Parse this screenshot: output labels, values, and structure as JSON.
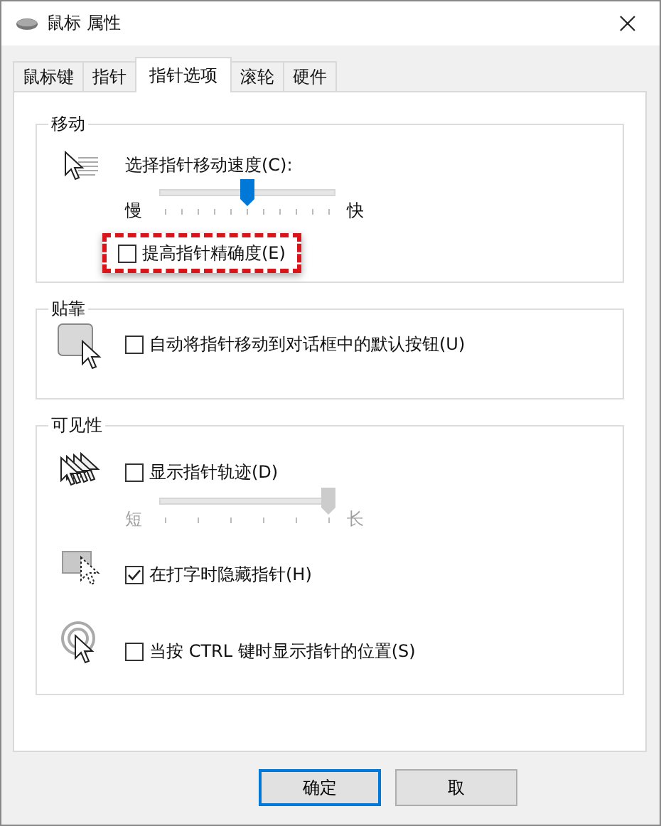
{
  "window": {
    "title": "鼠标 属性"
  },
  "tabs": [
    {
      "label": "鼠标键",
      "selected": false
    },
    {
      "label": "指针",
      "selected": false
    },
    {
      "label": "指针选项",
      "selected": true
    },
    {
      "label": "滚轮",
      "selected": false
    },
    {
      "label": "硬件",
      "selected": false
    }
  ],
  "groups": [
    {
      "title": "移动",
      "sections": [
        {
          "items": [
            {
              "kind": "label",
              "text": "选择指针移动速度(C):"
            },
            {
              "kind": "slider",
              "min_label": "慢",
              "max_label": "快",
              "level": 0.5,
              "disabled": false
            }
          ]
        },
        {
          "items": [
            {
              "kind": "checkbox",
              "label": "提高指针精确度(E)",
              "checked": false,
              "highlighted": true
            }
          ]
        }
      ]
    },
    {
      "title": "贴靠",
      "sections": [
        {
          "items": [
            {
              "kind": "checkbox",
              "label": "自动将指针移动到对话框中的默认按钮(U)",
              "checked": false,
              "highlighted": false
            }
          ]
        }
      ]
    },
    {
      "title": "可见性",
      "sections": [
        {
          "items": [
            {
              "kind": "checkbox",
              "label": "显示指针轨迹(D)",
              "checked": false,
              "highlighted": false
            },
            {
              "kind": "slider",
              "min_label": "短",
              "max_label": "长",
              "level": 1.0,
              "disabled": true
            }
          ]
        },
        {
          "items": [
            {
              "kind": "checkbox",
              "label": "在打字时隐藏指针(H)",
              "checked": true,
              "highlighted": false
            }
          ]
        },
        {
          "items": [
            {
              "kind": "checkbox",
              "label": "当按 CTRL 键时显示指针的位置(S)",
              "checked": false,
              "highlighted": false
            }
          ]
        }
      ]
    }
  ],
  "buttons": [
    {
      "label": "确定",
      "default": true
    },
    {
      "label": "取",
      "default": false
    }
  ]
}
